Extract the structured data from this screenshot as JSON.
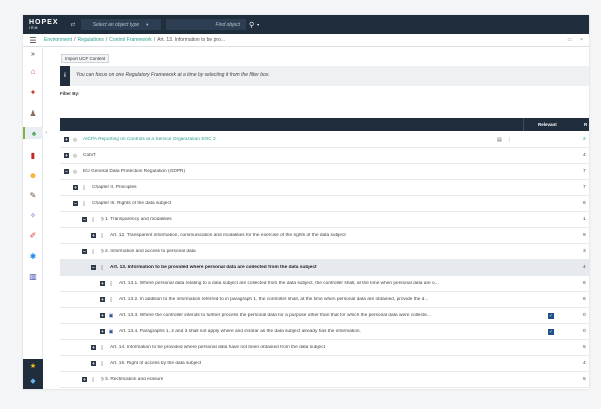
{
  "header": {
    "logo_main": "HOPEX",
    "logo_sub": "IRM",
    "object_type_placeholder": "Select an object type",
    "find_object_placeholder": "Find object"
  },
  "breadcrumb": {
    "items": [
      "Environment",
      "Regulations",
      "Control Framework"
    ],
    "current": "Art. 13. Information to be pro..."
  },
  "toolbar": {
    "import_label": "Import UCF Content"
  },
  "info": {
    "icon": "i",
    "text": "You can focus on one Regulatory Framework at a time by selecting it from the filter box."
  },
  "filter": {
    "label": "Filter By:"
  },
  "grid": {
    "col_relevant": "Relevant",
    "col_r": "R",
    "rows": [
      {
        "label": "AICPA Reporting on Controls at a Service Organization SOC 2",
        "count": "2",
        "expander": "+",
        "icon": "globe-icon"
      },
      {
        "label": "CobiT",
        "count": "4",
        "expander": "+",
        "icon": "globe-icon"
      },
      {
        "label": "EU General Data Protection Regulation (GDPR)",
        "count": "7",
        "expander": "−",
        "icon": "globe-icon"
      },
      {
        "label": "Chapter II. Principles",
        "count": "7",
        "expander": "+",
        "icon": "document-icon"
      },
      {
        "label": "Chapter III. Rights of the data subject",
        "count": "6",
        "expander": "−",
        "icon": "document-icon"
      },
      {
        "label": "§ 1. Transparency and modalities",
        "count": "1",
        "expander": "−",
        "icon": "document-icon"
      },
      {
        "label": "Art. 12. Transparent information, communication and modalities for the exercise of the rights of the data subject",
        "count": "9",
        "expander": "+",
        "icon": "document-icon"
      },
      {
        "label": "§ 2. Information and access to personal data",
        "count": "3",
        "expander": "−",
        "icon": "document-icon"
      },
      {
        "label": "Art. 13. Information to be provided where personal data are collected from the data subject",
        "count": "4",
        "expander": "−",
        "icon": "document-icon"
      },
      {
        "label": "Art. 13.1. Where personal data relating to a data subject are collected from the data subject, the controller shall, at the time when personal data are o...",
        "count": "6",
        "expander": "+",
        "icon": "document-icon"
      },
      {
        "label": "Art. 13.2. In addition to the information referred to in paragraph 1, the controller shall, at the time when personal data are obtained, provide the d...",
        "count": "6",
        "expander": "+",
        "icon": "document-icon"
      },
      {
        "label": "Art. 13.3. Where the controller intends to further process the personal data for a purpose other than that for which the personal data were collecte...",
        "count": "0",
        "expander": "+",
        "icon": "linked-document-icon"
      },
      {
        "label": "Art. 13.4. Paragraphs 1, 2 and 3 shall not apply where and insofar as the data subject already has the information.",
        "count": "0",
        "expander": "+",
        "icon": "linked-document-icon"
      },
      {
        "label": "Art. 14. Information to be provided where personal data have not been obtained from the data subject",
        "count": "5",
        "expander": "+",
        "icon": "document-icon"
      },
      {
        "label": "Art. 15. Right of access by the data subject",
        "count": "4",
        "expander": "+",
        "icon": "document-icon"
      },
      {
        "label": "§ 3. Rectification and erasure",
        "count": "5",
        "expander": "+",
        "icon": "document-icon"
      }
    ]
  },
  "colors": {
    "header_bg": "#1f2d3d",
    "accent_green": "#2a9d8f",
    "check_blue": "#1f4f8a"
  }
}
